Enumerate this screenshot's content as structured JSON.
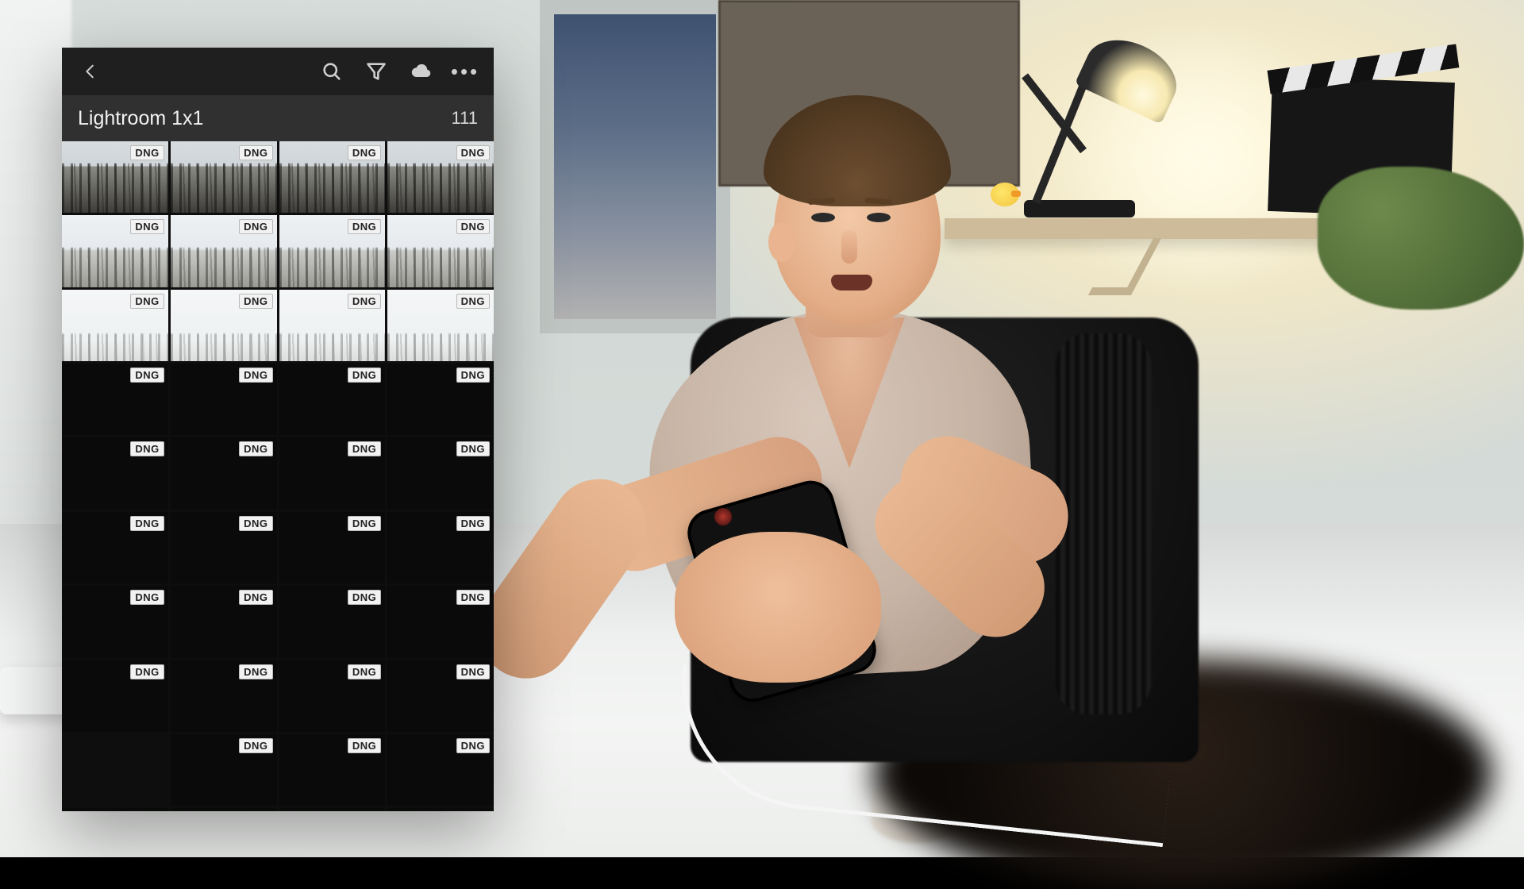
{
  "app": {
    "album_title": "Lightroom 1x1",
    "photo_count": "111",
    "badge_label": "DNG"
  },
  "toolbar": {
    "back": "Back",
    "search": "Search",
    "filter": "Filter",
    "cloud": "Cloud sync",
    "more": "More options"
  },
  "grid": {
    "columns": 4,
    "rows": [
      {
        "cells": [
          {
            "loaded": true,
            "tone": "dark"
          },
          {
            "loaded": true,
            "tone": "dark"
          },
          {
            "loaded": true,
            "tone": "dark"
          },
          {
            "loaded": true,
            "tone": "dark"
          }
        ]
      },
      {
        "cells": [
          {
            "loaded": true,
            "tone": "bright"
          },
          {
            "loaded": true,
            "tone": "bright"
          },
          {
            "loaded": true,
            "tone": "bright"
          },
          {
            "loaded": true,
            "tone": "bright"
          }
        ]
      },
      {
        "cells": [
          {
            "loaded": true,
            "tone": "verybright"
          },
          {
            "loaded": true,
            "tone": "verybright"
          },
          {
            "loaded": true,
            "tone": "verybright"
          },
          {
            "loaded": true,
            "tone": "verybright"
          }
        ]
      },
      {
        "cells": [
          {
            "loaded": false
          },
          {
            "loaded": false
          },
          {
            "loaded": false
          },
          {
            "loaded": false
          }
        ]
      },
      {
        "cells": [
          {
            "loaded": false
          },
          {
            "loaded": false
          },
          {
            "loaded": false
          },
          {
            "loaded": false
          }
        ]
      },
      {
        "cells": [
          {
            "loaded": false
          },
          {
            "loaded": false
          },
          {
            "loaded": false
          },
          {
            "loaded": false
          }
        ]
      },
      {
        "cells": [
          {
            "loaded": false
          },
          {
            "loaded": false
          },
          {
            "loaded": false
          },
          {
            "loaded": false
          }
        ]
      },
      {
        "cells": [
          {
            "loaded": false
          },
          {
            "loaded": false
          },
          {
            "loaded": false
          },
          {
            "loaded": false
          }
        ]
      },
      {
        "cells": [
          null,
          {
            "loaded": false
          },
          {
            "loaded": false
          },
          {
            "loaded": false
          }
        ]
      },
      {
        "cells": [
          {
            "loaded": false,
            "partial": true
          },
          {
            "loaded": false,
            "partial": true
          },
          {
            "loaded": false,
            "partial": true
          },
          {
            "loaded": false,
            "partial": true
          }
        ]
      }
    ]
  }
}
